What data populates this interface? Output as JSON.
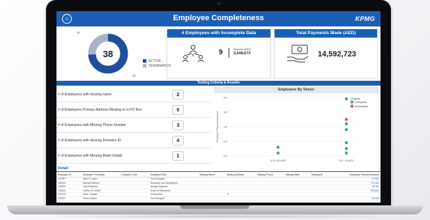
{
  "header": {
    "title": "Employee Completeness",
    "logo": "KPMG",
    "home_icon": "home-icon"
  },
  "donut": {
    "center_value": "38",
    "small_top": "10",
    "small_bottom": "28",
    "legend": [
      {
        "label": "ACTIVE",
        "color": "#1f4e9c"
      },
      {
        "label": "TERMINATED",
        "color": "#aab4c8"
      }
    ],
    "active_fraction": 0.74
  },
  "incomplete_card": {
    "title": "# Employees with Incomplete Data",
    "count": "9",
    "payment_label": "Payment (AED)",
    "payment_value": "3,648,673",
    "icon": "users-network-icon"
  },
  "payments_card": {
    "title": "Total Payments Made (AED)",
    "value": "14,592,723",
    "icon": "money-hand-icon"
  },
  "band": {
    "title": "Testing Criteria & Results"
  },
  "criteria": [
    {
      "text": "# of Employees with missing name",
      "count": "2"
    },
    {
      "text": "# of Employees Primary Address Missing or is PO Box",
      "count": "0"
    },
    {
      "text": "# of Employees with Missing Phone Number",
      "count": "3"
    },
    {
      "text": "# of Employees with missing Emirates ID",
      "count": "4"
    },
    {
      "text": "# of Employees with Missing Bank Details",
      "count": "1"
    }
  ],
  "chart_data": {
    "type": "scatter",
    "title": "Employees By Tenure",
    "ylabel": "Employee Payment Amount",
    "categories": [
      "5-10 YEARS",
      "10+ YEARS"
    ],
    "y_ticks": [
      "4M",
      "3M",
      "2M",
      "1M",
      "0M"
    ],
    "ylim": [
      0,
      4
    ],
    "legend_title": "Legend",
    "series": [
      {
        "name": "Complete",
        "color": "#3fa98b",
        "points": [
          {
            "x": "5-10 YEARS",
            "y": 0.6
          },
          {
            "x": "5-10 YEARS",
            "y": 0.2
          },
          {
            "x": "10+ YEARS",
            "y": 3.9
          },
          {
            "x": "10+ YEARS",
            "y": 2.2
          },
          {
            "x": "10+ YEARS",
            "y": 1.8
          },
          {
            "x": "10+ YEARS",
            "y": 0.9
          },
          {
            "x": "10+ YEARS",
            "y": 0.5
          },
          {
            "x": "10+ YEARS",
            "y": 0.2
          }
        ]
      },
      {
        "name": "Incomplete",
        "color": "#d9534f",
        "points": [
          {
            "x": "10+ YEARS",
            "y": 2.5
          }
        ]
      }
    ]
  },
  "detail": {
    "title": "Detail",
    "columns": [
      "Employee ID",
      "Employee Full Name",
      "Company Code",
      "Employee Role",
      "Missing Name",
      "Missing Address",
      "Missing Phone",
      "Missing Bank",
      "Missing ID",
      "Employee Payment Amount"
    ],
    "rows": [
      [
        "127957",
        "Rafe F Lopez",
        "",
        "Tool Designer",
        "",
        "",
        "",
        "",
        "",
        "57,553"
      ],
      [
        "182492",
        "Michael Nielsen",
        "",
        "Research and Developme...",
        "",
        "",
        "",
        "",
        "",
        "273,082"
      ],
      [
        "193920",
        "Cail A Brisbon",
        "",
        "Design Engineer",
        "",
        "",
        "",
        "",
        "",
        "46,763"
      ],
      [
        "195253",
        "Carlton D Liebert",
        "",
        "Head of Resources",
        "",
        "",
        "",
        "",
        "",
        "878,803"
      ],
      [
        "232103",
        "Zelik J Jaeger",
        "",
        "Accountant",
        "",
        "X",
        "",
        "",
        "",
        ""
      ],
      [
        "232307",
        "Vince A Adler",
        "",
        "Tool Designer",
        "",
        "",
        "",
        "",
        "",
        "56,063"
      ]
    ]
  }
}
